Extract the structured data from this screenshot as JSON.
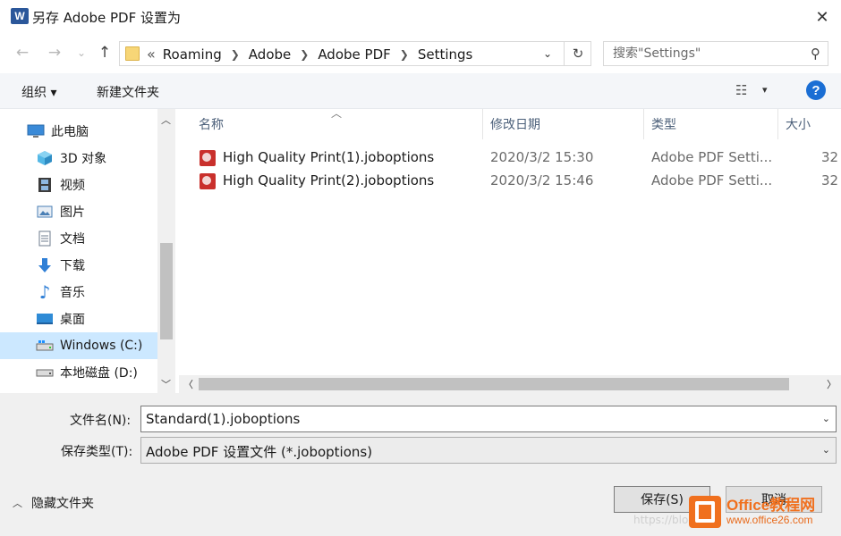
{
  "window": {
    "title": "另存 Adobe PDF 设置为",
    "app_icon": "W"
  },
  "nav": {
    "back_icon": "←",
    "forward_icon": "→",
    "recent_icon": "⌄",
    "up_icon": "↑",
    "address": {
      "prefix": "«",
      "crumbs": [
        "Roaming",
        "Adobe",
        "Adobe PDF",
        "Settings"
      ]
    },
    "refresh_icon": "↻",
    "search_placeholder": "搜索\"Settings\""
  },
  "toolbar": {
    "organize": "组织 ▾",
    "new_folder": "新建文件夹",
    "view_icon": "☷",
    "view_dd": "▾",
    "help": "?"
  },
  "sidebar": {
    "items": [
      {
        "label": "此电脑",
        "icon": "computer-icon",
        "glyph": "🖥",
        "color": "#3a8ad8"
      },
      {
        "label": "3D 对象",
        "icon": "cube-icon",
        "glyph": "◆",
        "color": "#3fa7d6"
      },
      {
        "label": "视频",
        "icon": "film-icon",
        "glyph": "▦",
        "color": "#555555"
      },
      {
        "label": "图片",
        "icon": "picture-icon",
        "glyph": "▭",
        "color": "#4a7fb5"
      },
      {
        "label": "文档",
        "icon": "document-icon",
        "glyph": "▤",
        "color": "#6d7b8d"
      },
      {
        "label": "下载",
        "icon": "download-icon",
        "glyph": "⬇",
        "color": "#2f7fd6"
      },
      {
        "label": "音乐",
        "icon": "music-icon",
        "glyph": "♪",
        "color": "#2f7fd6"
      },
      {
        "label": "桌面",
        "icon": "desktop-icon",
        "glyph": "▬",
        "color": "#2f8bd6"
      },
      {
        "label": "Windows  (C:)",
        "icon": "drive-c-icon",
        "glyph": "▭",
        "color": "#5a5a5a"
      },
      {
        "label": "本地磁盘 (D:)",
        "icon": "drive-d-icon",
        "glyph": "▭",
        "color": "#5a5a5a"
      }
    ],
    "selected_index": 8
  },
  "files": {
    "columns": [
      "名称",
      "修改日期",
      "类型",
      "大小"
    ],
    "rows": [
      {
        "name": "High Quality Print(1).joboptions",
        "date": "2020/3/2 15:30",
        "type": "Adobe PDF Setti...",
        "size": "32"
      },
      {
        "name": "High Quality Print(2).joboptions",
        "date": "2020/3/2 15:46",
        "type": "Adobe PDF Setti...",
        "size": "32"
      }
    ]
  },
  "form": {
    "filename_label": "文件名(N):",
    "filename_value": "Standard(1).joboptions",
    "type_label": "保存类型(T):",
    "type_value": "Adobe PDF 设置文件 (*.joboptions)"
  },
  "footer": {
    "hide_folders": "隐藏文件夹",
    "save": "保存(S)",
    "cancel": "取消"
  },
  "watermark": "https://blog",
  "badge": {
    "main": "Office教程网",
    "url": "www.office26.com"
  },
  "colors": {
    "accent": "#0078d7",
    "selected": "#cce8ff",
    "brand": "#f0701e"
  }
}
